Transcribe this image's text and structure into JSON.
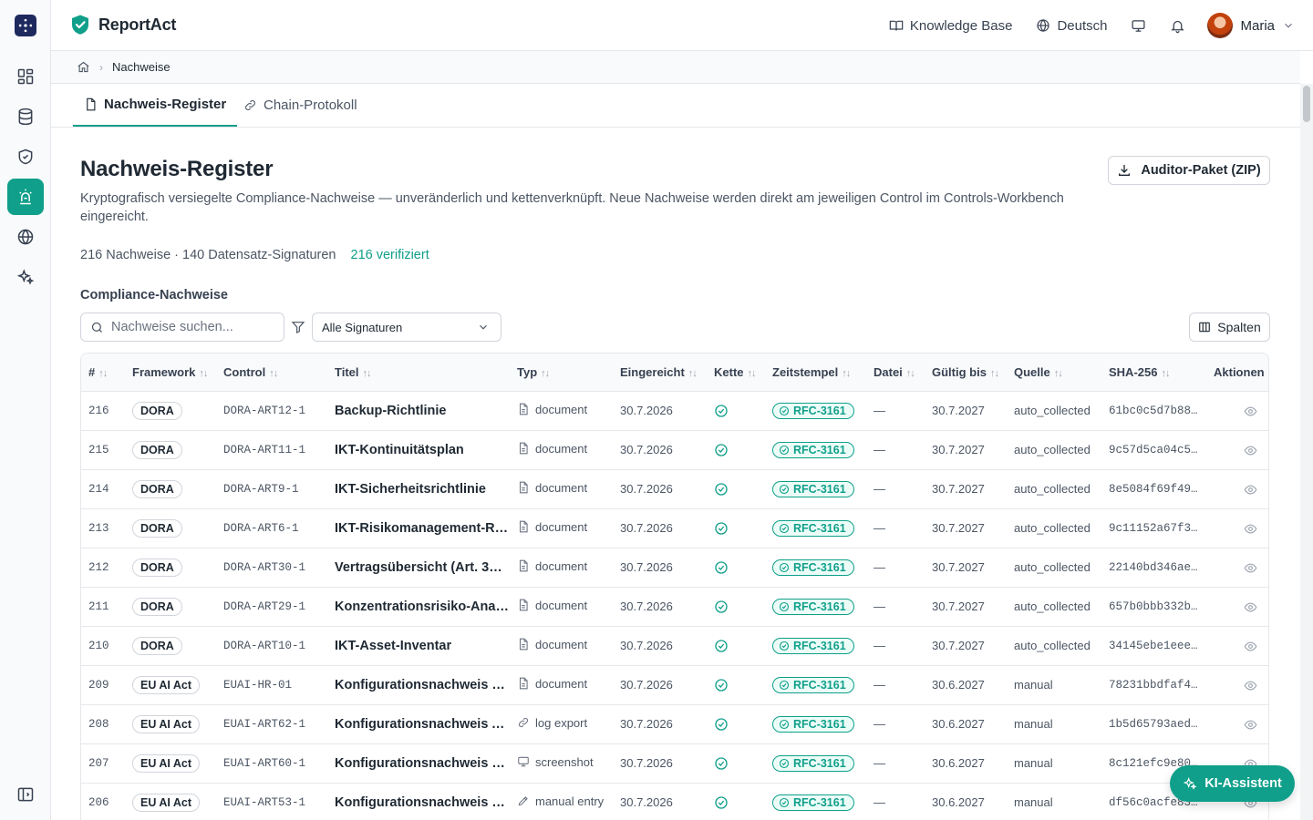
{
  "brand": {
    "name": "ReportAct"
  },
  "topbar": {
    "knowledge_base": "Knowledge Base",
    "language": "Deutsch",
    "user_name": "Maria"
  },
  "breadcrumb": {
    "current": "Nachweise"
  },
  "tabs": [
    {
      "label": "Nachweis-Register",
      "active": true
    },
    {
      "label": "Chain-Protokoll",
      "active": false
    }
  ],
  "header": {
    "title": "Nachweis-Register",
    "description": "Kryptografisch versiegelte Compliance-Nachweise — unveränderlich und kettenverknüpft. Neue Nachweise werden direkt am jeweiligen Control im Controls-Workbench eingereicht.",
    "auditor_button": "Auditor-Paket (ZIP)",
    "stats_text": "216 Nachweise · 140 Datensatz-Signaturen",
    "verified_text": "216 verifiziert"
  },
  "section": {
    "title": "Compliance-Nachweise"
  },
  "filters": {
    "search_placeholder": "Nachweise suchen...",
    "signature_select": "Alle Signaturen",
    "columns_button": "Spalten"
  },
  "table": {
    "columns": [
      "#",
      "Framework",
      "Control",
      "Titel",
      "Typ",
      "Eingereicht",
      "Kette",
      "Zeitstempel",
      "Datei",
      "Gültig bis",
      "Quelle",
      "SHA-256",
      "Aktionen"
    ],
    "rows": [
      {
        "id": "216",
        "framework": "DORA",
        "control": "DORA-ART12-1",
        "title": "Backup-Richtlinie",
        "type": "document",
        "type_icon": "document-icon",
        "submitted": "30.7.2026",
        "timestamp": "RFC-3161",
        "file": "—",
        "valid_until": "30.7.2027",
        "source": "auto_collected",
        "sha": "61bc0c5d7b88…"
      },
      {
        "id": "215",
        "framework": "DORA",
        "control": "DORA-ART11-1",
        "title": "IKT-Kontinuitätsplan",
        "type": "document",
        "type_icon": "document-icon",
        "submitted": "30.7.2026",
        "timestamp": "RFC-3161",
        "file": "—",
        "valid_until": "30.7.2027",
        "source": "auto_collected",
        "sha": "9c57d5ca04c5…"
      },
      {
        "id": "214",
        "framework": "DORA",
        "control": "DORA-ART9-1",
        "title": "IKT-Sicherheitsrichtlinie",
        "type": "document",
        "type_icon": "document-icon",
        "submitted": "30.7.2026",
        "timestamp": "RFC-3161",
        "file": "—",
        "valid_until": "30.7.2027",
        "source": "auto_collected",
        "sha": "8e5084f69f49…"
      },
      {
        "id": "213",
        "framework": "DORA",
        "control": "DORA-ART6-1",
        "title": "IKT-Risikomanagement-R…",
        "type": "document",
        "type_icon": "document-icon",
        "submitted": "30.7.2026",
        "timestamp": "RFC-3161",
        "file": "—",
        "valid_until": "30.7.2027",
        "source": "auto_collected",
        "sha": "9c11152a67f3…"
      },
      {
        "id": "212",
        "framework": "DORA",
        "control": "DORA-ART30-1",
        "title": "Vertragsübersicht (Art. 3…",
        "type": "document",
        "type_icon": "document-icon",
        "submitted": "30.7.2026",
        "timestamp": "RFC-3161",
        "file": "—",
        "valid_until": "30.7.2027",
        "source": "auto_collected",
        "sha": "22140bd346ae…"
      },
      {
        "id": "211",
        "framework": "DORA",
        "control": "DORA-ART29-1",
        "title": "Konzentrationsrisiko-Anal…",
        "type": "document",
        "type_icon": "document-icon",
        "submitted": "30.7.2026",
        "timestamp": "RFC-3161",
        "file": "—",
        "valid_until": "30.7.2027",
        "source": "auto_collected",
        "sha": "657b0bbb332b…"
      },
      {
        "id": "210",
        "framework": "DORA",
        "control": "DORA-ART10-1",
        "title": "IKT-Asset-Inventar",
        "type": "document",
        "type_icon": "document-icon",
        "submitted": "30.7.2026",
        "timestamp": "RFC-3161",
        "file": "—",
        "valid_until": "30.7.2027",
        "source": "auto_collected",
        "sha": "34145ebe1eee…"
      },
      {
        "id": "209",
        "framework": "EU AI Act",
        "control": "EUAI-HR-01",
        "title": "Konfigurationsnachweis …",
        "type": "document",
        "type_icon": "document-icon",
        "submitted": "30.7.2026",
        "timestamp": "RFC-3161",
        "file": "—",
        "valid_until": "30.6.2027",
        "source": "manual",
        "sha": "78231bbdfaf4…"
      },
      {
        "id": "208",
        "framework": "EU AI Act",
        "control": "EUAI-ART62-1",
        "title": "Konfigurationsnachweis A…",
        "type": "log export",
        "type_icon": "link-icon",
        "submitted": "30.7.2026",
        "timestamp": "RFC-3161",
        "file": "—",
        "valid_until": "30.6.2027",
        "source": "manual",
        "sha": "1b5d65793aed…"
      },
      {
        "id": "207",
        "framework": "EU AI Act",
        "control": "EUAI-ART60-1",
        "title": "Konfigurationsnachweis P…",
        "type": "screenshot",
        "type_icon": "monitor-icon",
        "submitted": "30.7.2026",
        "timestamp": "RFC-3161",
        "file": "—",
        "valid_until": "30.6.2027",
        "source": "manual",
        "sha": "8c121efc9e80…"
      },
      {
        "id": "206",
        "framework": "EU AI Act",
        "control": "EUAI-ART53-1",
        "title": "Konfigurationsnachweis C…",
        "type": "manual entry",
        "type_icon": "pen-icon",
        "submitted": "30.7.2026",
        "timestamp": "RFC-3161",
        "file": "—",
        "valid_until": "30.6.2027",
        "source": "manual",
        "sha": "df56c0acfe83…"
      }
    ]
  },
  "assistant": {
    "label": "KI-Assistent"
  }
}
